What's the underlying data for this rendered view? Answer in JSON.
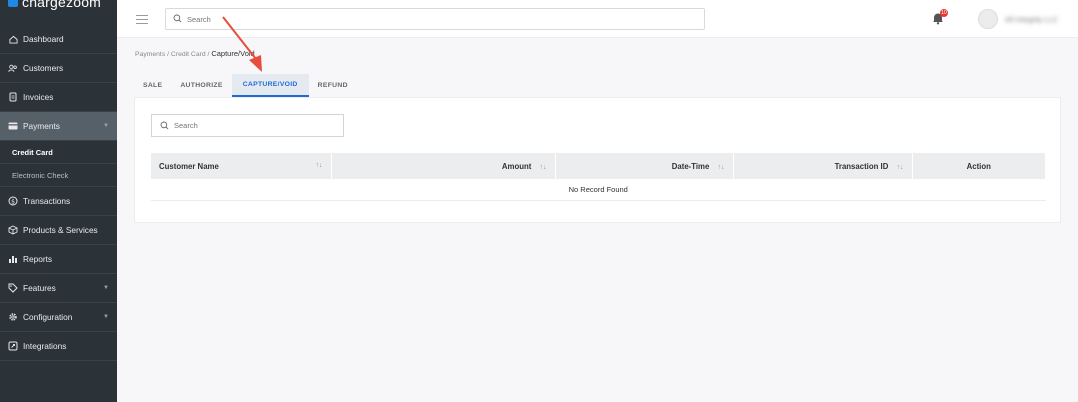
{
  "brand": {
    "name": "chargezoom"
  },
  "sidebar": {
    "items": [
      {
        "label": "Dashboard",
        "icon": "home-icon"
      },
      {
        "label": "Customers",
        "icon": "users-icon"
      },
      {
        "label": "Invoices",
        "icon": "invoice-icon"
      },
      {
        "label": "Payments",
        "icon": "card-icon",
        "active": true,
        "expandable": true,
        "children": [
          {
            "label": "Credit Card",
            "current": true
          },
          {
            "label": "Electronic Check"
          }
        ]
      },
      {
        "label": "Transactions",
        "icon": "dollar-icon"
      },
      {
        "label": "Products & Services",
        "icon": "box-icon"
      },
      {
        "label": "Reports",
        "icon": "chart-icon"
      },
      {
        "label": "Features",
        "icon": "tag-icon",
        "expandable": true
      },
      {
        "label": "Configuration",
        "icon": "gear-icon",
        "expandable": true
      },
      {
        "label": "Integrations",
        "icon": "plug-icon"
      }
    ]
  },
  "topbar": {
    "search_placeholder": "Search",
    "notifications_count": "10",
    "user_name": "All Integrity LLC"
  },
  "breadcrumb": {
    "p1": "Payments",
    "p2": "Credit Card",
    "current": "Capture/Void"
  },
  "tabs": [
    {
      "label": "SALE"
    },
    {
      "label": "AUTHORIZE"
    },
    {
      "label": "CAPTURE/VOID",
      "active": true
    },
    {
      "label": "REFUND"
    }
  ],
  "table": {
    "search_placeholder": "Search",
    "columns": [
      "Customer Name",
      "Amount",
      "Date-Time",
      "Transaction ID",
      "Action"
    ],
    "empty_message": "No Record Found"
  },
  "colors": {
    "accent": "#1e6bd6",
    "sidebar": "#2b3238",
    "annotation": "#e74c3c"
  }
}
